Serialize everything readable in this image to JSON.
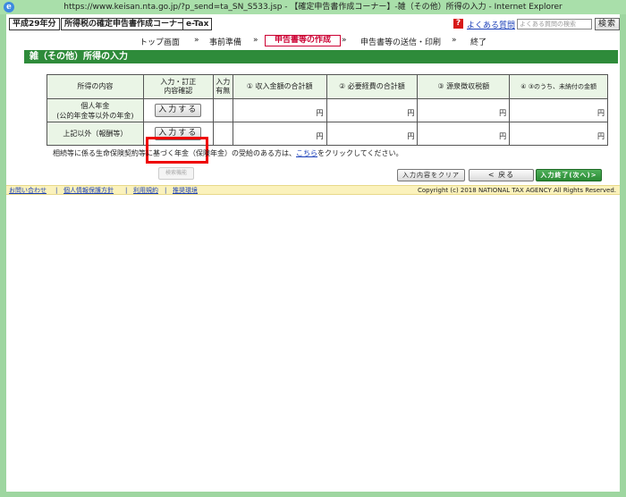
{
  "window": {
    "title": "https://www.keisan.nta.go.jp/?p_send=ta_SN_S533.jsp - 【確定申告書作成コーナー】-雑（その他）所得の入力 - Internet Explorer",
    "ie_icon": "e"
  },
  "header": {
    "year_badge": "平成29年分",
    "corner_badge": "所得税の確定申告書作成コーナー",
    "etax_badge": "e-Tax",
    "faq_icon": "?",
    "faq_link": "よくある質問",
    "faq_placeholder": "よくある質問の検索",
    "faq_search_button": "検索"
  },
  "steps": {
    "items": [
      "トップ画面",
      "事前準備",
      "申告書等の作成",
      "申告書等の送信・印刷",
      "終了"
    ],
    "separator": "»"
  },
  "page_title": "雑（その他）所得の入力",
  "table": {
    "headers": [
      "所得の内容",
      "入力・訂正\n内容確認",
      "入力\n有無",
      "①  収入金額の合計額",
      "②  必要経費の合計額",
      "③  源泉徴収税額",
      "④  ③のうち、未納付の金額"
    ],
    "rows": [
      {
        "label": "個人年金\n(公的年金等以外の年金)",
        "button": "入力する",
        "status": "",
        "v1": "円",
        "v2": "円",
        "v3": "円",
        "v4": "円"
      },
      {
        "label": "上記以外（報酬等）",
        "button": "入力する",
        "status": "",
        "v1": "円",
        "v2": "円",
        "v3": "円",
        "v4": "円"
      }
    ]
  },
  "note": {
    "before": "相続等に係る生命保険契約等に基づく年金（保険年金）の受給のある方は、",
    "link": "こちら",
    "after": "をクリックしてください。"
  },
  "buttons": {
    "disabled": "検索機能",
    "clear": "入力内容をクリア",
    "back": "< 戻る",
    "next": "入力終了(次へ)>"
  },
  "footer": {
    "links": [
      "お問い合わせ",
      "個人情報保護方針",
      "利用規約",
      "推奨環境"
    ],
    "separator": "|",
    "copyright": "Copyright (c) 2018 NATIONAL TAX AGENCY All Rights Reserved."
  }
}
